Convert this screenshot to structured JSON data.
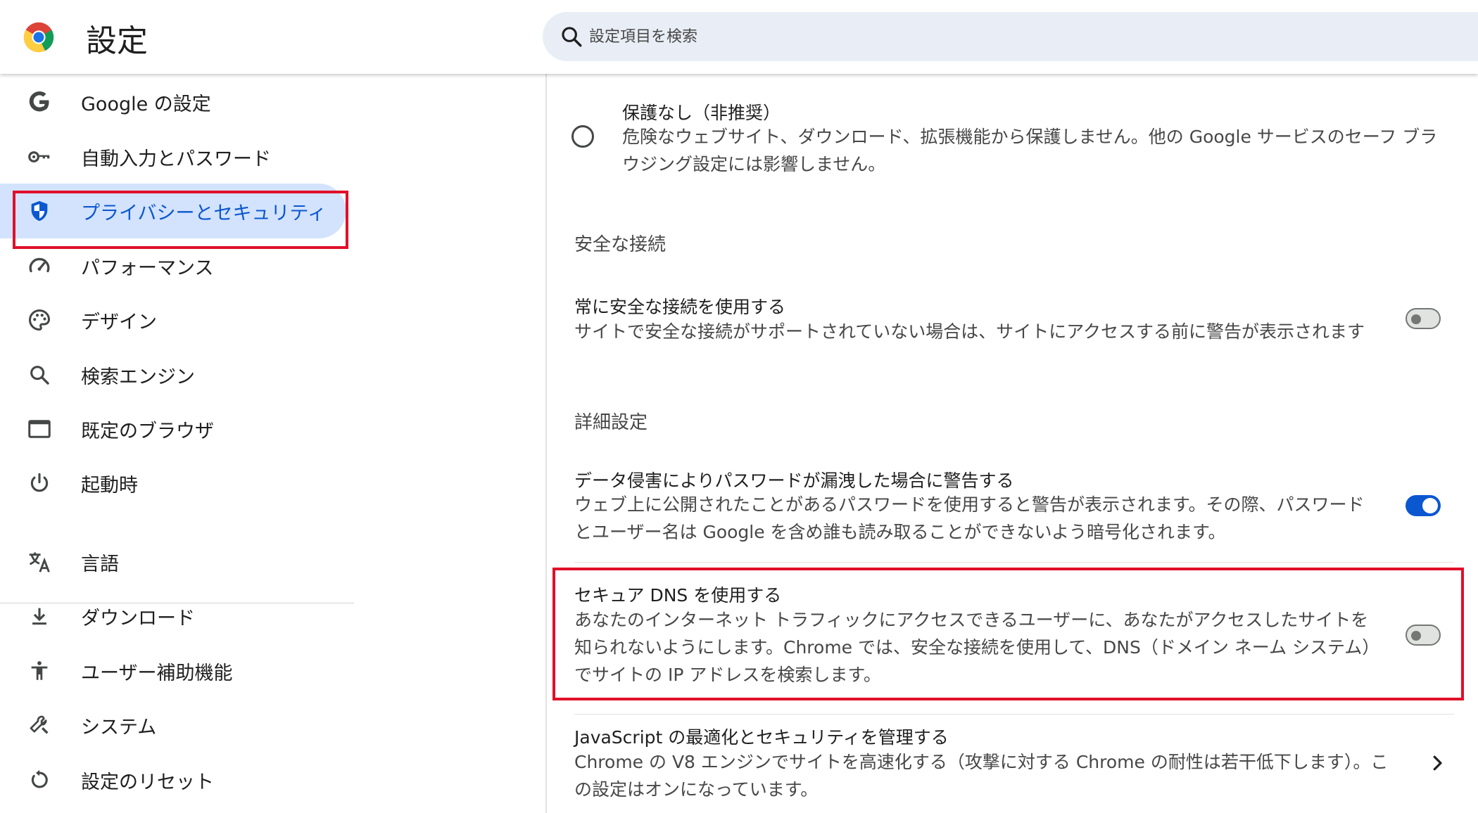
{
  "app": {
    "title": "設定",
    "search_placeholder": "設定項目を検索"
  },
  "sidebar": {
    "items": [
      {
        "label": "Google の設定",
        "icon": "google-g-icon"
      },
      {
        "label": "自動入力とパスワード",
        "icon": "key-icon"
      },
      {
        "label": "プライバシーとセキュリティ",
        "icon": "shield-icon",
        "active": true
      },
      {
        "label": "パフォーマンス",
        "icon": "speedometer-icon"
      },
      {
        "label": "デザイン",
        "icon": "palette-icon"
      },
      {
        "label": "検索エンジン",
        "icon": "search-icon"
      },
      {
        "label": "既定のブラウザ",
        "icon": "browser-window-icon"
      },
      {
        "label": "起動時",
        "icon": "power-icon"
      },
      {
        "label": "言語",
        "icon": "translate-icon"
      },
      {
        "label": "ダウンロード",
        "icon": "download-icon"
      },
      {
        "label": "ユーザー補助機能",
        "icon": "accessibility-icon"
      },
      {
        "label": "システム",
        "icon": "wrench-icon"
      },
      {
        "label": "設定のリセット",
        "icon": "reset-icon"
      }
    ]
  },
  "main": {
    "no_protection": {
      "title": "保護なし（非推奨）",
      "desc_line1": "危険なウェブサイト、ダウンロード、拡張機能から保護しません。他の Google サービスのセーフ ブラ",
      "desc_line2": "ウジング設定には影響しません。"
    },
    "secure_connections": {
      "heading": "安全な接続",
      "title": "常に安全な接続を使用する",
      "desc": "サイトで安全な接続がサポートされていない場合は、サイトにアクセスする前に警告が表示されます",
      "enabled": false
    },
    "advanced": {
      "heading": "詳細設定",
      "password_leak": {
        "title": "データ侵害によりパスワードが漏洩した場合に警告する",
        "desc_line1": "ウェブ上に公開されたことがあるパスワードを使用すると警告が表示されます。その際、パスワード",
        "desc_line2": "とユーザー名は Google を含め誰も読み取ることができないよう暗号化されます。",
        "enabled": true
      },
      "secure_dns": {
        "title": "セキュア DNS を使用する",
        "desc_line1": "あなたのインターネット トラフィックにアクセスできるユーザーに、あなたがアクセスしたサイトを",
        "desc_line2": "知られないようにします。Chrome では、安全な接続を使用して、DNS（ドメイン ネーム システム）",
        "desc_line3": "でサイトの IP アドレスを検索します。",
        "enabled": false
      },
      "javascript": {
        "title": "JavaScript の最適化とセキュリティを管理する",
        "desc_line1": "Chrome の V8 エンジンでサイトを高速化する（攻撃に対する Chrome の耐性は若干低下します）。こ",
        "desc_line2": "の設定はオンになっています。"
      }
    }
  },
  "colors": {
    "accent": "#0b57d0",
    "highlight": "#e0102a",
    "active_nav_bg": "#d3e3fd"
  }
}
